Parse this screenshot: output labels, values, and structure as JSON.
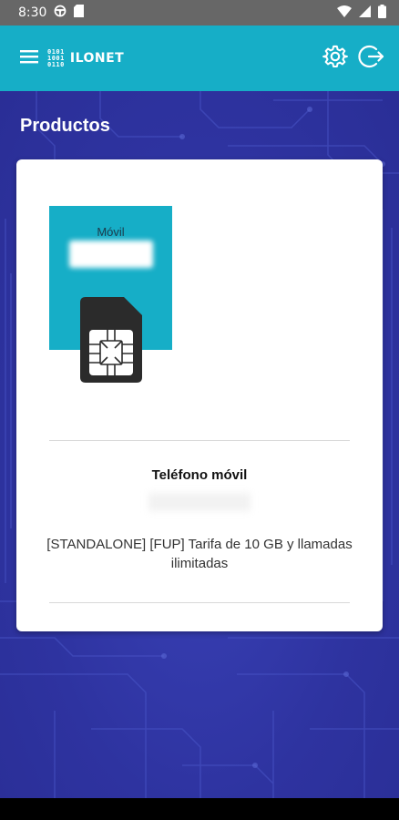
{
  "status_bar": {
    "time": "8:30",
    "icons_left": [
      "steering-wheel-icon",
      "sd-card-icon"
    ],
    "icons_right": [
      "wifi-icon",
      "signal-icon",
      "battery-icon"
    ]
  },
  "app_bar": {
    "logo_bits": [
      "0101",
      "1001",
      "0110"
    ],
    "logo_text": "ILONET",
    "icons": [
      "menu-icon",
      "settings-icon",
      "logout-icon"
    ]
  },
  "page": {
    "title": "Productos"
  },
  "product": {
    "image_label": "Móvil",
    "type": "Teléfono móvil",
    "description": "[STANDALONE] [FUP] Tarifa de 10 GB y llamadas ilimitadas"
  },
  "colors": {
    "app_bar": "#16aec7",
    "background": "#2e33a0",
    "status_bar": "#676767",
    "card": "#ffffff"
  }
}
